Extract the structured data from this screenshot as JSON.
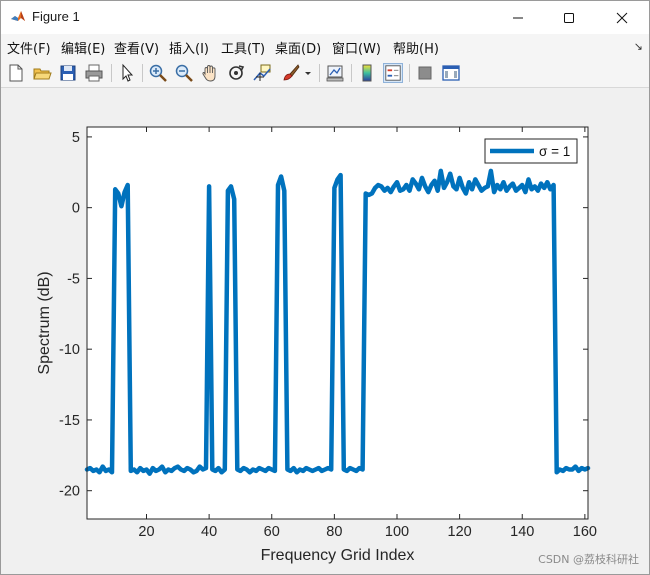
{
  "window": {
    "title": "Figure 1",
    "icon": "matlab-logo-icon",
    "controls": [
      "minimize-icon",
      "maximize-icon",
      "close-icon"
    ]
  },
  "menu": {
    "items": [
      "文件(F)",
      "编辑(E)",
      "查看(V)",
      "插入(I)",
      "工具(T)",
      "桌面(D)",
      "窗口(W)",
      "帮助(H)"
    ]
  },
  "toolbar": {
    "tools": [
      "new-figure-icon",
      "open-file-icon",
      "save-icon",
      "print-icon",
      "pointer-icon",
      "zoom-in-icon",
      "zoom-out-icon",
      "pan-icon",
      "rotate-3d-icon",
      "data-cursor-icon",
      "brush-icon",
      "brush-dropdown-icon",
      "link-plot-icon",
      "colorbar-icon",
      "legend-icon",
      "hide-plot-tools-icon",
      "show-plot-tools-icon"
    ]
  },
  "chart_data": {
    "type": "line",
    "title": "",
    "xlabel": "Frequency Grid Index",
    "ylabel": "Spectrum (dB)",
    "xlim": [
      1,
      161
    ],
    "ylim": [
      -22,
      5.7
    ],
    "xticks": [
      20,
      40,
      60,
      80,
      100,
      120,
      140,
      160
    ],
    "yticks": [
      5,
      0,
      -5,
      -10,
      -15,
      -20
    ],
    "grid": false,
    "legend_position": "top-right",
    "series": [
      {
        "name": "σ = 1",
        "color": "#0072bd",
        "x": [
          1,
          2,
          3,
          4,
          5,
          6,
          7,
          8,
          9,
          10,
          11,
          12,
          13,
          14,
          15,
          16,
          17,
          18,
          19,
          20,
          21,
          22,
          23,
          24,
          25,
          26,
          27,
          28,
          29,
          30,
          31,
          32,
          33,
          34,
          35,
          36,
          37,
          38,
          39,
          40,
          41,
          42,
          43,
          44,
          45,
          46,
          47,
          48,
          49,
          50,
          51,
          52,
          53,
          54,
          55,
          56,
          57,
          58,
          59,
          60,
          61,
          62,
          63,
          64,
          65,
          66,
          67,
          68,
          69,
          70,
          71,
          72,
          73,
          74,
          75,
          76,
          77,
          78,
          79,
          80,
          81,
          82,
          83,
          84,
          85,
          86,
          87,
          88,
          89,
          90,
          91,
          92,
          93,
          94,
          95,
          96,
          97,
          98,
          99,
          100,
          101,
          102,
          103,
          104,
          105,
          106,
          107,
          108,
          109,
          110,
          111,
          112,
          113,
          114,
          115,
          116,
          117,
          118,
          119,
          120,
          121,
          122,
          123,
          124,
          125,
          126,
          127,
          128,
          129,
          130,
          131,
          132,
          133,
          134,
          135,
          136,
          137,
          138,
          139,
          140,
          141,
          142,
          143,
          144,
          145,
          146,
          147,
          148,
          149,
          150,
          151,
          152,
          153,
          154,
          155,
          156,
          157,
          158,
          159,
          160,
          161
        ],
        "y": [
          -18.5,
          -18.4,
          -18.6,
          -18.5,
          -18.7,
          -18.3,
          -18.6,
          -18.5,
          -18.7,
          1.3,
          1.0,
          0.1,
          1.1,
          1.6,
          -18.6,
          -18.5,
          -18.7,
          -18.4,
          -18.6,
          -18.5,
          -18.8,
          -18.4,
          -18.6,
          -18.5,
          -18.3,
          -18.7,
          -18.5,
          -18.6,
          -18.4,
          -18.3,
          -18.5,
          -18.6,
          -18.4,
          -18.5,
          -18.7,
          -18.6,
          -18.3,
          -18.5,
          -18.4,
          1.5,
          -18.5,
          -18.6,
          -18.4,
          -18.7,
          -18.5,
          1.2,
          1.5,
          0.6,
          -18.5,
          -18.6,
          -18.4,
          -18.5,
          -18.7,
          -18.5,
          -18.6,
          -18.4,
          -18.5,
          -18.6,
          -18.4,
          -18.5,
          -18.6,
          1.6,
          2.2,
          1.2,
          -18.5,
          -18.6,
          -18.4,
          -18.7,
          -18.5,
          -18.6,
          -18.4,
          -18.5,
          -18.6,
          -18.5,
          -18.4,
          -18.6,
          -18.5,
          -18.4,
          -18.5,
          1.4,
          2.0,
          2.3,
          -18.5,
          -18.6,
          -18.4,
          -18.5,
          -18.6,
          -18.4,
          -18.5,
          1.0,
          0.9,
          1.0,
          1.4,
          1.6,
          1.5,
          1.2,
          1.4,
          1.1,
          1.5,
          1.8,
          1.2,
          1.3,
          1.6,
          1.2,
          2.0,
          1.7,
          1.3,
          2.1,
          1.5,
          1.1,
          1.6,
          1.9,
          1.2,
          2.6,
          1.4,
          1.8,
          2.4,
          1.5,
          1.3,
          2.1,
          1.4,
          1.0,
          1.8,
          1.3,
          2.0,
          1.6,
          1.2,
          1.4,
          1.5,
          2.6,
          1.1,
          1.6,
          1.3,
          1.8,
          1.2,
          1.5,
          1.7,
          1.2,
          1.4,
          1.6,
          1.1,
          2.0,
          1.3,
          1.5,
          1.2,
          1.7,
          1.4,
          1.8,
          1.3,
          1.6,
          -18.7,
          -18.5,
          -18.6,
          -18.4,
          -18.5,
          -18.5,
          -18.3,
          -18.6,
          -18.4,
          -18.5,
          -18.4
        ]
      }
    ]
  },
  "watermark": "CSDN @荔枝科研社"
}
